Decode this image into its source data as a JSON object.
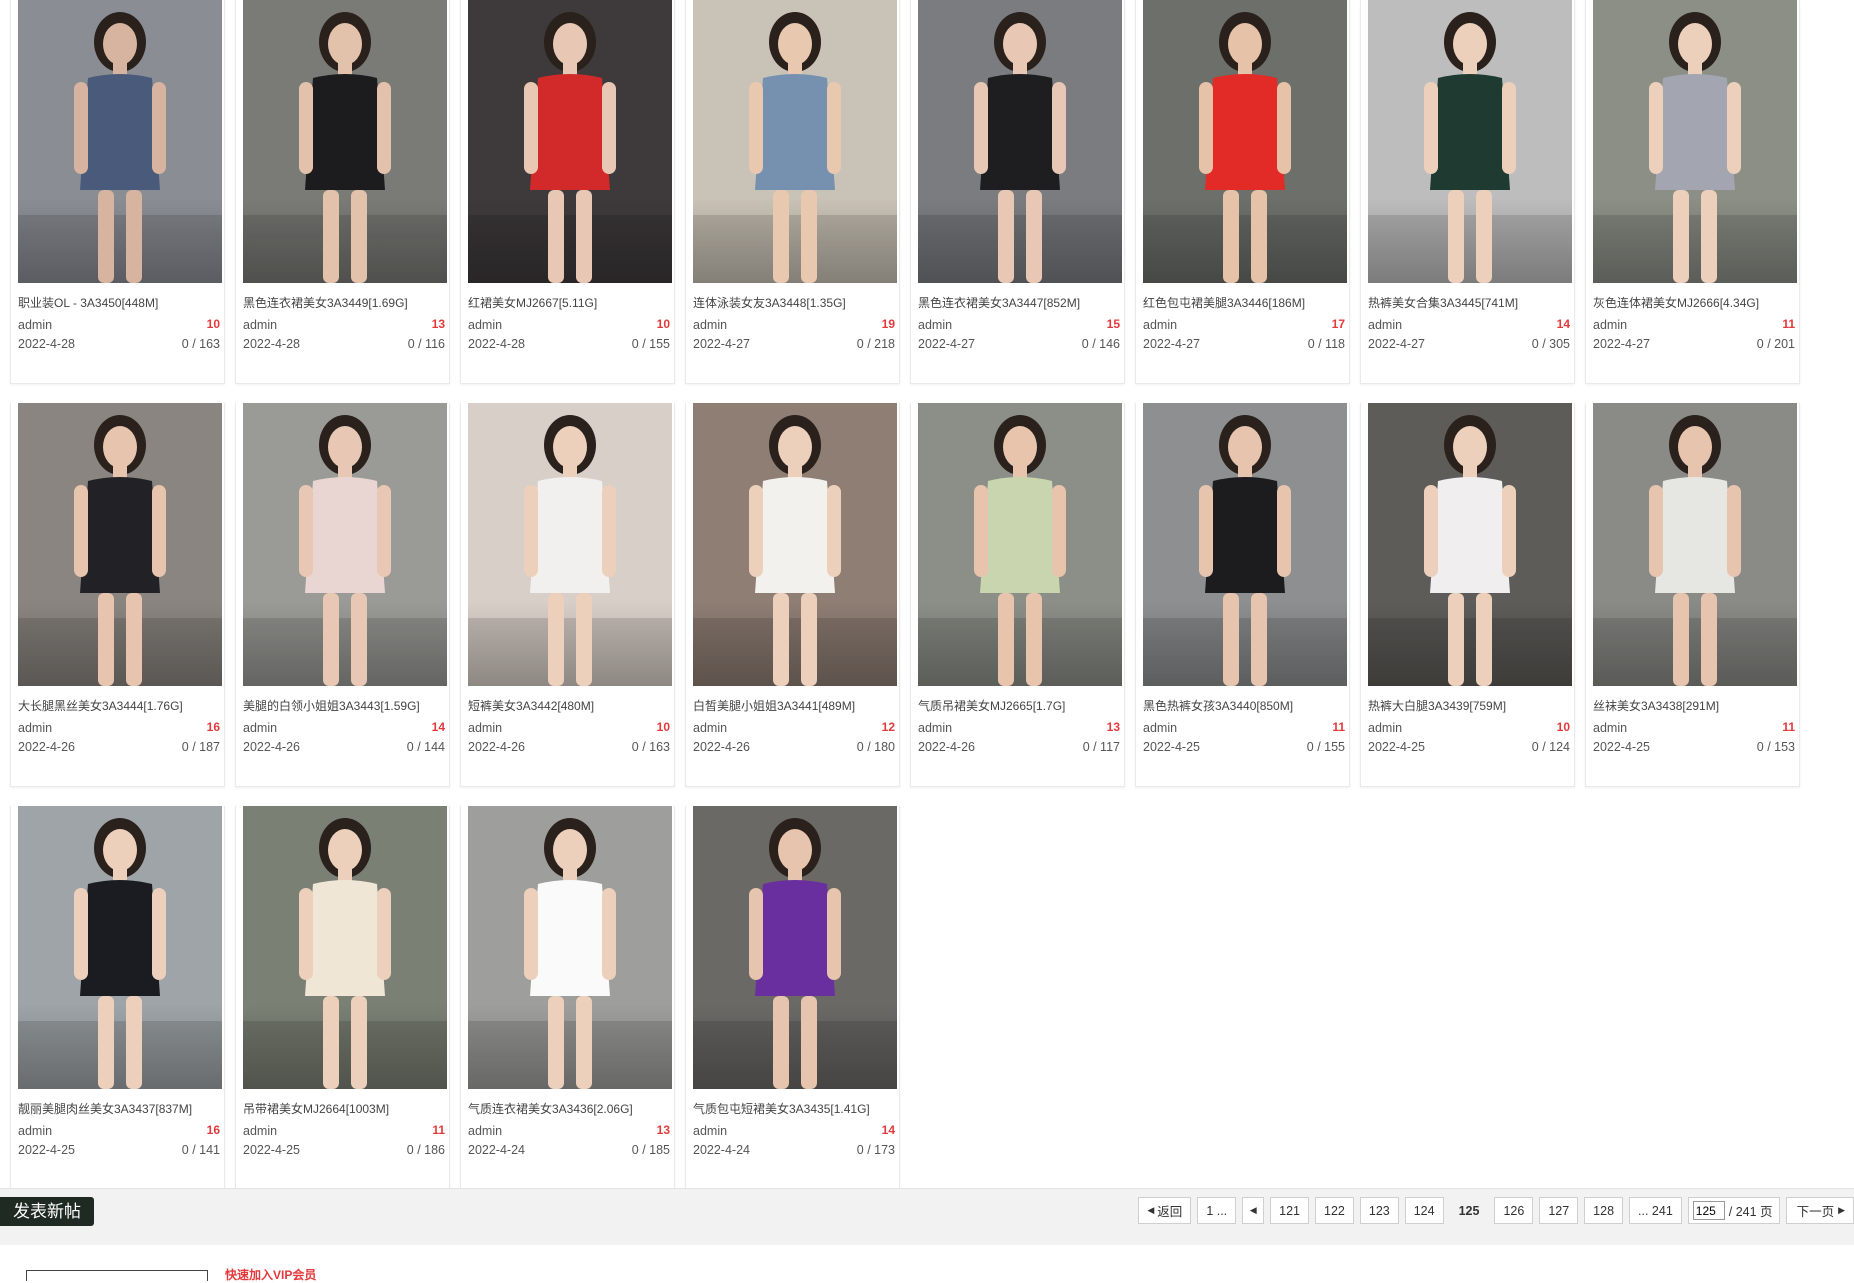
{
  "posts": [
    {
      "title": "职业装OL - 3A3450[448M]",
      "author": "admin",
      "replies": "10",
      "date": "2022-4-28",
      "stats": "0 / 163",
      "bg": "#8a8d94",
      "main": "#4a5a7a",
      "skin": "#d6b4a0"
    },
    {
      "title": "黑色连衣裙美女3A3449[1.69G]",
      "author": "admin",
      "replies": "13",
      "date": "2022-4-28",
      "stats": "0 / 116",
      "bg": "#7a7a76",
      "main": "#1c1c1e",
      "skin": "#e3c2ac"
    },
    {
      "title": "红裙美女MJ2667[5.11G]",
      "author": "admin",
      "replies": "10",
      "date": "2022-4-28",
      "stats": "0 / 155",
      "bg": "#3e3a3c",
      "main": "#d22a2a",
      "skin": "#e8c8b4"
    },
    {
      "title": "连体泳装女友3A3448[1.35G]",
      "author": "admin",
      "replies": "19",
      "date": "2022-4-27",
      "stats": "0 / 218",
      "bg": "#c9c2b6",
      "main": "#7691b0",
      "skin": "#e9c8b0"
    },
    {
      "title": "黑色连衣裙美女3A3447[852M]",
      "author": "admin",
      "replies": "15",
      "date": "2022-4-27",
      "stats": "0 / 146",
      "bg": "#7a7c80",
      "main": "#1e1e20",
      "skin": "#e8c8b4"
    },
    {
      "title": "红色包屯裙美腿3A3446[186M]",
      "author": "admin",
      "replies": "17",
      "date": "2022-4-27",
      "stats": "0 / 118",
      "bg": "#6c6f6a",
      "main": "#e22b26",
      "skin": "#e6c2a8"
    },
    {
      "title": "热裤美女合集3A3445[741M]",
      "author": "admin",
      "replies": "14",
      "date": "2022-4-27",
      "stats": "0 / 305",
      "bg": "#bdbdbd",
      "main": "#1f3a30",
      "skin": "#ecd0bc"
    },
    {
      "title": "灰色连体裙美女MJ2666[4.34G]",
      "author": "admin",
      "replies": "11",
      "date": "2022-4-27",
      "stats": "0 / 201",
      "bg": "#8b8f86",
      "main": "#a3a6b0",
      "skin": "#ecd0bc"
    },
    {
      "title": "大长腿黑丝美女3A3444[1.76G]",
      "author": "admin",
      "replies": "16",
      "date": "2022-4-26",
      "stats": "0 / 187",
      "bg": "#8a8580",
      "main": "#222226",
      "skin": "#e6c4ae"
    },
    {
      "title": "美腿的白领小姐姐3A3443[1.59G]",
      "author": "admin",
      "replies": "14",
      "date": "2022-4-26",
      "stats": "0 / 144",
      "bg": "#9a9a96",
      "main": "#e9d6d2",
      "skin": "#e8c8b4"
    },
    {
      "title": "短裤美女3A3442[480M]",
      "author": "admin",
      "replies": "10",
      "date": "2022-4-26",
      "stats": "0 / 163",
      "bg": "#d8cfc8",
      "main": "#f2f0ee",
      "skin": "#ecd0bc"
    },
    {
      "title": "白皙美腿小姐姐3A3441[489M]",
      "author": "admin",
      "replies": "12",
      "date": "2022-4-26",
      "stats": "0 / 180",
      "bg": "#8e7e74",
      "main": "#f3f1ee",
      "skin": "#ecd0bc"
    },
    {
      "title": "气质吊裙美女MJ2665[1.7G]",
      "author": "admin",
      "replies": "13",
      "date": "2022-4-26",
      "stats": "0 / 117",
      "bg": "#8c8f88",
      "main": "#c9d5ae",
      "skin": "#e8c4ac"
    },
    {
      "title": "黑色热裤女孩3A3440[850M]",
      "author": "admin",
      "replies": "11",
      "date": "2022-4-25",
      "stats": "0 / 155",
      "bg": "#8d8f90",
      "main": "#1c1c1e",
      "skin": "#e6c4ae"
    },
    {
      "title": "热裤大白腿3A3439[759M]",
      "author": "admin",
      "replies": "10",
      "date": "2022-4-25",
      "stats": "0 / 124",
      "bg": "#5e5c58",
      "main": "#f0eeee",
      "skin": "#ecd0bc"
    },
    {
      "title": "丝袜美女3A3438[291M]",
      "author": "admin",
      "replies": "11",
      "date": "2022-4-25",
      "stats": "0 / 153",
      "bg": "#8a8a86",
      "main": "#e6e6e2",
      "skin": "#e6c4ae"
    },
    {
      "title": "靓丽美腿肉丝美女3A3437[837M]",
      "author": "admin",
      "replies": "16",
      "date": "2022-4-25",
      "stats": "0 / 141",
      "bg": "#9ea4a8",
      "main": "#1b1b22",
      "skin": "#ecd0bc"
    },
    {
      "title": "吊带裙美女MJ2664[1003M]",
      "author": "admin",
      "replies": "11",
      "date": "2022-4-25",
      "stats": "0 / 186",
      "bg": "#7a8074",
      "main": "#efe6d6",
      "skin": "#ecd0bc"
    },
    {
      "title": "气质连衣裙美女3A3436[2.06G]",
      "author": "admin",
      "replies": "13",
      "date": "2022-4-24",
      "stats": "0 / 185",
      "bg": "#9e9e9c",
      "main": "#fafafa",
      "skin": "#ecd0bc"
    },
    {
      "title": "气质包屯短裙美女3A3435[1.41G]",
      "author": "admin",
      "replies": "14",
      "date": "2022-4-24",
      "stats": "0 / 173",
      "bg": "#6b6966",
      "main": "#6a2f9e",
      "skin": "#e6c4ae"
    }
  ],
  "toolbar": {
    "post_button": "发表新帖"
  },
  "pagination": {
    "back": "返回",
    "first": "1 ...",
    "pages": [
      "121",
      "122",
      "123",
      "124",
      "125",
      "126",
      "127",
      "128"
    ],
    "current": "125",
    "last": "... 241",
    "jump_value": "125",
    "total_label": "/ 241 页",
    "next": "下一页"
  },
  "bottom": {
    "link": "快速加入VIP会员"
  }
}
